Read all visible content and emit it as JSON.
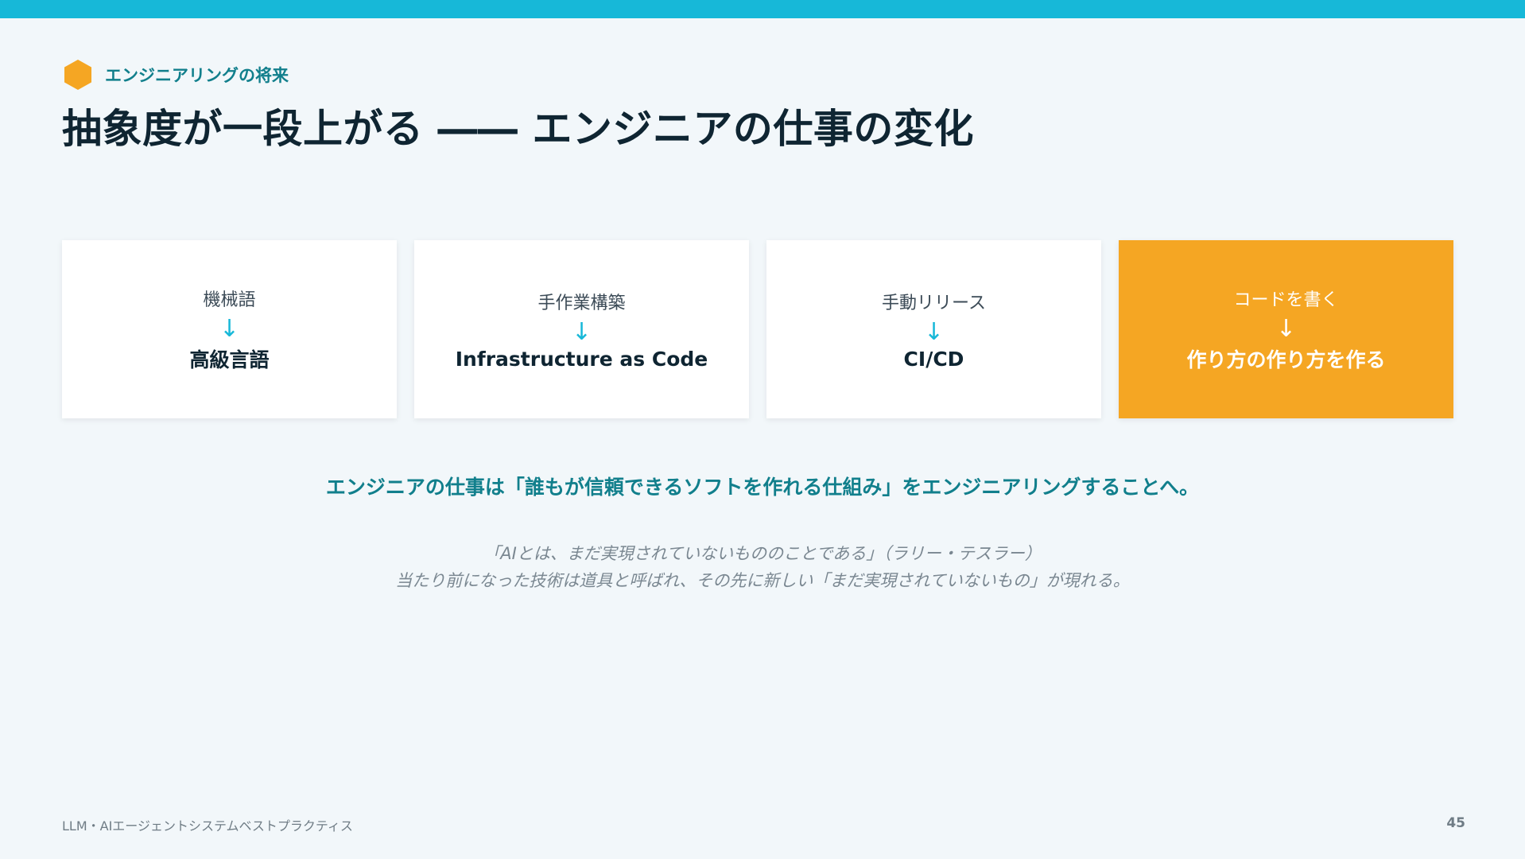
{
  "colors": {
    "accent": "#17b8d8",
    "teal": "#117f8c",
    "orange": "#f5a623",
    "title": "#0f2532"
  },
  "section_icon": "hexagon-icon",
  "section_label": "エンジニアリングの将来",
  "title": "抽象度が一段上がる ―― エンジニアの仕事の変化",
  "cards": [
    {
      "from": "機械語",
      "arrow": "↓",
      "to": "高級言語"
    },
    {
      "from": "手作業構築",
      "arrow": "↓",
      "to": "Infrastructure as Code"
    },
    {
      "from": "手動リリース",
      "arrow": "↓",
      "to": "CI/CD"
    },
    {
      "from": "コードを書く",
      "arrow": "↓",
      "to": "作り方の作り方を作る"
    }
  ],
  "conclusion": "エンジニアの仕事は「誰もが信頼できるソフトを作れる仕組み」をエンジニアリングすることへ。",
  "quote": {
    "line1": "「AIとは、まだ実現されていないもののことである」（ラリー・テスラー）",
    "line2": "当たり前になった技術は道具と呼ばれ、その先に新しい「まだ実現されていないもの」が現れる。"
  },
  "footer": {
    "left": "LLM・AIエージェントシステムベストプラクティス",
    "page": "45"
  }
}
